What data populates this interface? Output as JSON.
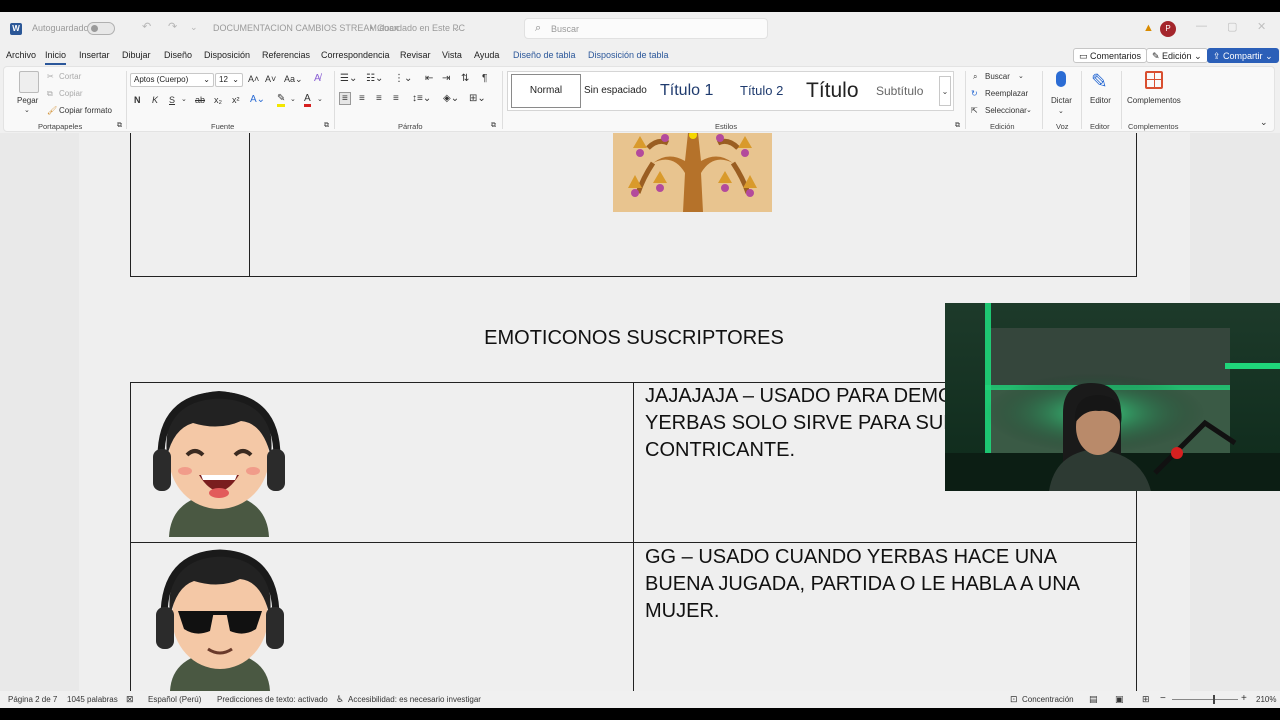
{
  "titlebar": {
    "autosave_label": "Autoguardado",
    "doc_title": "DOCUMENTACION CAMBIOS STREAM.docx",
    "save_status": "Guardado en Este PC",
    "search_placeholder": "Buscar",
    "avatar_initial": "P"
  },
  "menu": {
    "tabs": [
      "Archivo",
      "Inicio",
      "Insertar",
      "Dibujar",
      "Diseño",
      "Disposición",
      "Referencias",
      "Correspondencia",
      "Revisar",
      "Vista",
      "Ayuda"
    ],
    "context_tabs": [
      "Diseño de tabla",
      "Disposición de tabla"
    ],
    "comments": "Comentarios",
    "editing_mode": "Edición",
    "share": "Compartir"
  },
  "ribbon": {
    "clipboard": {
      "paste": "Pegar",
      "cut": "Cortar",
      "copy": "Copiar",
      "format_painter": "Copiar formato",
      "group": "Portapapeles"
    },
    "font": {
      "family": "Aptos (Cuerpo)",
      "size": "12",
      "bold": "N",
      "italic": "K",
      "underline": "S",
      "group": "Fuente"
    },
    "paragraph": {
      "group": "Párrafo"
    },
    "styles": {
      "items": [
        "Normal",
        "Sin espaciado",
        "Título 1",
        "Título 2",
        "Título",
        "Subtítulo"
      ],
      "group": "Estilos"
    },
    "editing": {
      "find": "Buscar",
      "replace": "Reemplazar",
      "select": "Seleccionar",
      "group": "Edición"
    },
    "voice": {
      "dictate": "Dictar",
      "group": "Voz"
    },
    "editor": {
      "label": "Editor",
      "group": "Editor"
    },
    "addins": {
      "label": "Complementos",
      "group": "Complementos"
    }
  },
  "document": {
    "section_title": "EMOTICONOS SUSCRIPTORES",
    "rows": [
      {
        "text": "JAJAJAJA – USADO PARA DEMOS\nYERBAS SOLO SIRVE PARA SUB\nCONTRICANTE."
      },
      {
        "text": "GG – USADO CUANDO YERBAS HACE UNA\nBUENA JUGADA, PARTIDA O LE HABLA A UNA\nMUJER."
      }
    ]
  },
  "statusbar": {
    "page": "Página 2 de 7",
    "words": "1045 palabras",
    "language": "Español (Perú)",
    "predictions": "Predicciones de texto: activado",
    "accessibility": "Accesibilidad: es necesario investigar",
    "focus": "Concentración",
    "zoom": "210%"
  },
  "colors": {
    "accent": "#2b579a",
    "share_bg": "#2b5fb8",
    "webcam_green": "#1fd67a"
  }
}
